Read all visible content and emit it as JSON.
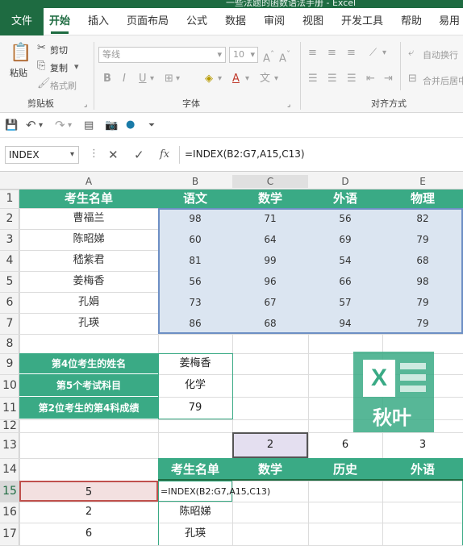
{
  "window": {
    "title": "一些法题的函数语法手册 - Excel"
  },
  "tabs": [
    "文件",
    "开始",
    "插入",
    "页面布局",
    "公式",
    "数据",
    "审阅",
    "视图",
    "开发工具",
    "帮助",
    "易用"
  ],
  "ribbon": {
    "paste": "粘贴",
    "cut": "剪切",
    "copy": "复制",
    "format_painter": "格式刷",
    "clipboard_group": "剪贴板",
    "font_name": "等线",
    "font_size": "10",
    "font_group": "字体",
    "wrap_text": "自动换行",
    "merge_center": "合并后居中",
    "align_group": "对齐方式"
  },
  "formula_bar": {
    "name_box": "INDEX",
    "fx": "fx",
    "formula": "=INDEX(B2:G7,A15,C13)"
  },
  "columns": [
    "A",
    "B",
    "C",
    "D",
    "E"
  ],
  "rows": [
    "1",
    "2",
    "3",
    "4",
    "5",
    "6",
    "7",
    "8",
    "9",
    "10",
    "11",
    "12",
    "13",
    "14",
    "15",
    "16",
    "17"
  ],
  "table1": {
    "headers": [
      "考生名单",
      "语文",
      "数学",
      "外语",
      "物理"
    ],
    "rows": [
      [
        "曹福兰",
        "98",
        "71",
        "56",
        "82"
      ],
      [
        "陈昭娣",
        "60",
        "64",
        "69",
        "79"
      ],
      [
        "嵇紫君",
        "81",
        "99",
        "54",
        "68"
      ],
      [
        "姜梅香",
        "56",
        "96",
        "66",
        "98"
      ],
      [
        "孔娟",
        "73",
        "67",
        "57",
        "79"
      ],
      [
        "孔瑛",
        "86",
        "68",
        "94",
        "79"
      ]
    ]
  },
  "lookup": {
    "labels": [
      "第4位考生的姓名",
      "第5个考试科目",
      "第2位考生的第4科成绩"
    ],
    "values": [
      "姜梅香",
      "化学",
      "79"
    ]
  },
  "row13": [
    "2",
    "6",
    "3"
  ],
  "table2": {
    "headers": [
      "考生名单",
      "数学",
      "历史",
      "外语"
    ],
    "a_values": [
      "5",
      "2",
      "6"
    ],
    "b_values": [
      "=INDEX(B2:G7,A15,C13)",
      "陈昭娣",
      "孔瑛"
    ]
  },
  "watermark": {
    "text": "秋叶",
    "logo_letter": "X"
  }
}
